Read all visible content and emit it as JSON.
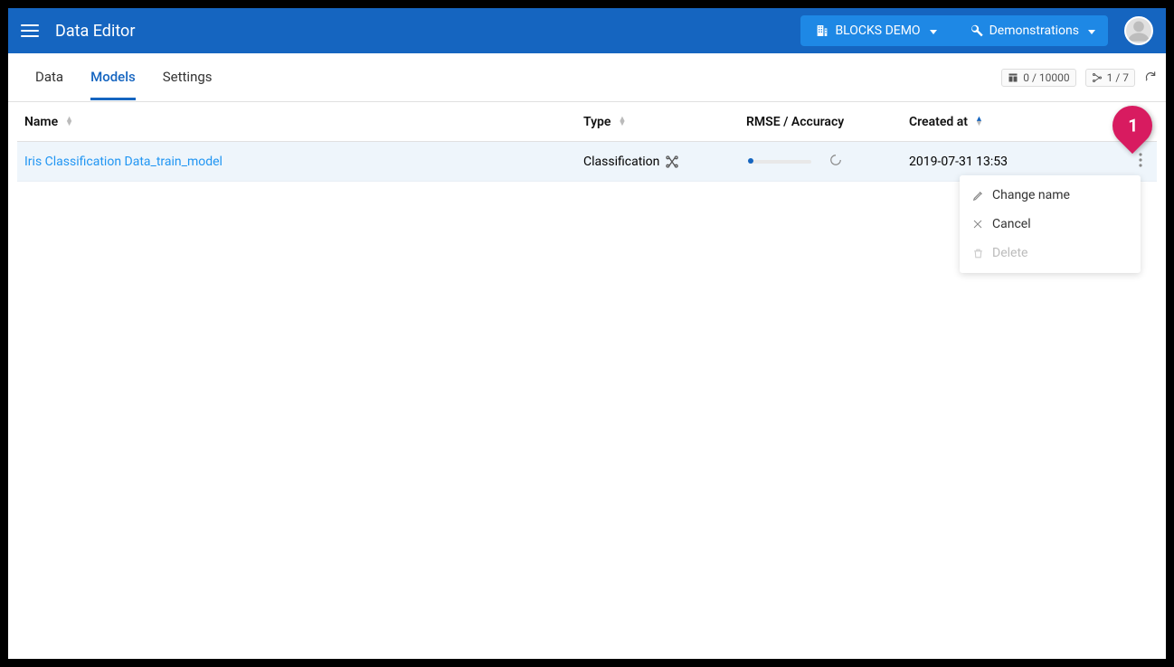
{
  "header": {
    "title": "Data Editor",
    "crumb1": {
      "label": "BLOCKS DEMO"
    },
    "crumb2": {
      "label": "Demonstrations"
    }
  },
  "tabs": {
    "data": "Data",
    "models": "Models",
    "settings": "Settings"
  },
  "counters": {
    "rows": "0 / 10000",
    "models": "1 / 7"
  },
  "columns": {
    "name": "Name",
    "type": "Type",
    "rmse": "RMSE / Accuracy",
    "created": "Created at"
  },
  "rows": [
    {
      "name": "Iris Classification Data_train_model",
      "type": "Classification",
      "created": "2019-07-31 13:53"
    }
  ],
  "menu": {
    "rename": "Change name",
    "cancel": "Cancel",
    "delete": "Delete"
  },
  "pin": {
    "label": "1"
  }
}
